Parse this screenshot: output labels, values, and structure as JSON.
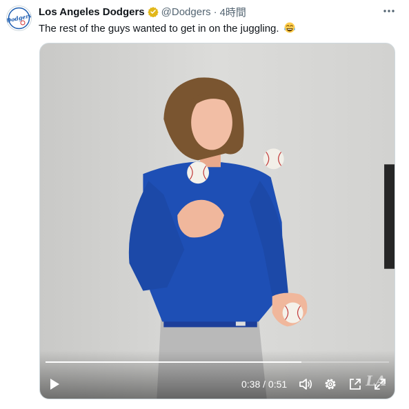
{
  "tweet": {
    "author_name": "Los Angeles Dodgers",
    "handle": "@Dodgers",
    "separator": "·",
    "time_ago": "4時間",
    "text": "The rest of the guys wanted to get in on the juggling.",
    "emoji": "face-with-tears-of-joy",
    "verified": true,
    "verified_color": "#e2b719",
    "avatar_logo_text": "Dodgers",
    "avatar_logo_color": "#1a5bb0"
  },
  "video": {
    "current_time": "0:38",
    "duration": "0:51",
    "time_separator": "/",
    "progress_fraction": 0.745,
    "watermark": "LA",
    "icons": [
      "play-icon",
      "volume-icon",
      "settings-icon",
      "popout-icon",
      "fullscreen-icon"
    ]
  },
  "colors": {
    "text_primary": "#0f1419",
    "text_secondary": "#536471",
    "jersey_blue": "#1e4fb5",
    "wall": "#d6d6d4"
  }
}
